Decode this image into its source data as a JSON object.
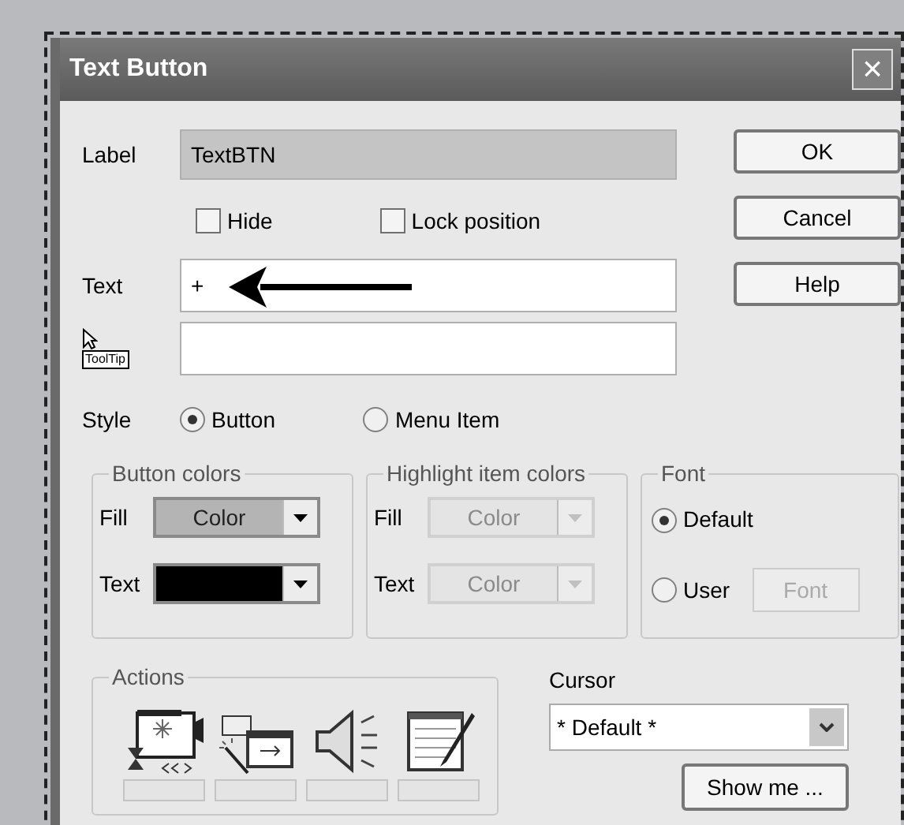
{
  "window": {
    "title": "Text Button",
    "close": "×"
  },
  "label_field": {
    "label": "Label",
    "value": "TextBTN"
  },
  "checkboxes": [
    {
      "label": "Hide",
      "checked": false
    },
    {
      "label": "Lock position",
      "checked": false
    }
  ],
  "text_field": {
    "label": "Text",
    "value": "+"
  },
  "tooltip_field": {
    "badge": "ToolTip"
  },
  "style": {
    "label": "Style",
    "options": [
      {
        "label": "Button",
        "selected": true
      },
      {
        "label": "Menu Item",
        "selected": false
      }
    ]
  },
  "button_colors": {
    "title": "Button colors",
    "disabled": false,
    "rows": [
      {
        "label": "Fill",
        "value": "Color",
        "color": "#b4b4b4"
      },
      {
        "label": "Text",
        "value": "",
        "color": "#000000"
      }
    ]
  },
  "highlight_colors": {
    "title": "Highlight item colors",
    "disabled": true,
    "rows": [
      {
        "label": "Fill",
        "value": "Color",
        "color": "#e4e4e4"
      },
      {
        "label": "Text",
        "value": "Color",
        "color": "#e4e4e4"
      }
    ]
  },
  "font": {
    "title": "Font",
    "options": [
      {
        "label": "Default",
        "selected": true
      },
      {
        "label": "User",
        "selected": false
      }
    ],
    "button": {
      "label": "Font",
      "disabled": true
    }
  },
  "actions": {
    "title": "Actions",
    "items": [
      {
        "kind": "movie"
      },
      {
        "kind": "wand"
      },
      {
        "kind": "sound"
      },
      {
        "kind": "note"
      }
    ]
  },
  "cursor": {
    "label": "Cursor",
    "value": "* Default *"
  },
  "buttons": [
    {
      "label": "OK"
    },
    {
      "label": "Cancel"
    },
    {
      "label": "Help"
    }
  ],
  "show_me": "Show me ..."
}
